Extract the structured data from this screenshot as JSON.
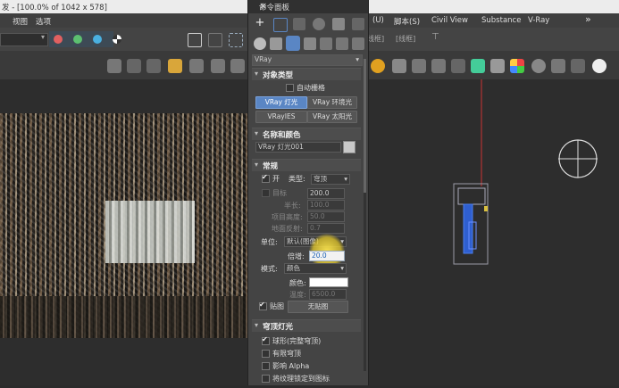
{
  "window": {
    "title": "发 - [100.0% of 1042 x 578]"
  },
  "menu_left": [
    "视图",
    "选项"
  ],
  "menu_right": [
    "(U)",
    "脚本(S)",
    "Civil View",
    "Substance",
    "V-Ray"
  ],
  "menu_more": "»",
  "subtoolbar_right": [
    "线框]",
    "[线框]"
  ],
  "panel": {
    "title": "命令面板",
    "close": "×",
    "renderer_select": "VRay",
    "object_type": {
      "header": "对象类型",
      "autogrid_label": "自动栅格",
      "buttons": [
        "VRay 灯光",
        "VRay 环境光",
        "VRayIES",
        "VRay 太阳光"
      ],
      "active_index": 0
    },
    "name_color": {
      "header": "名称和颜色",
      "name_value": "VRay 灯光001"
    },
    "general": {
      "header": "常规",
      "on_label": "开",
      "type_label": "类型:",
      "type_value": "穹顶",
      "target_label": "目标",
      "target_value": "200.0",
      "half_length_label": "半长:",
      "half_length_value": "100.0",
      "half_width_label": "项目高度:",
      "half_width_value": "50.0",
      "directional_label": "地面反射:",
      "directional_value": "0.7",
      "units_label": "单位:",
      "units_value": "默认(图像)",
      "multiplier_label": "倍增:",
      "multiplier_value": "20.0",
      "mode_label": "模式:",
      "mode_value": "颜色",
      "color_label": "颜色:",
      "color_swatch": "#ffffff",
      "temperature_label": "温度:",
      "temperature_value": "6500.0",
      "texture_label": "贴图",
      "texture_button": "无贴图"
    },
    "dome": {
      "header": "穹顶灯光",
      "options": [
        {
          "label": "球形(完整穹顶)",
          "checked": true
        },
        {
          "label": "有限穹顶",
          "checked": false
        },
        {
          "label": "影响 Alpha",
          "checked": false
        },
        {
          "label": "将纹理锁定到图标",
          "checked": false
        }
      ]
    },
    "collapse_mark": "▾"
  },
  "colors": {
    "accent": "#5a86c4",
    "highlight": "#f0d228",
    "red_dot": "#e06060",
    "green_dot": "#5cc070",
    "blue_dot": "#4ab0e0"
  }
}
